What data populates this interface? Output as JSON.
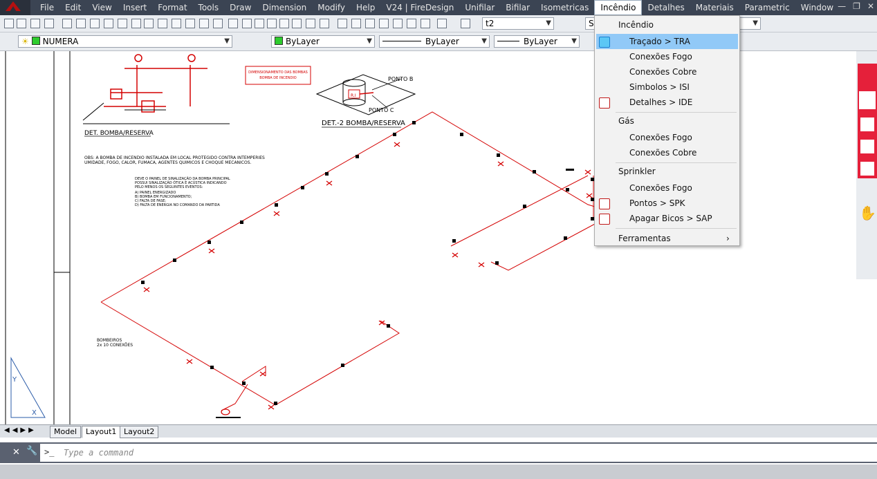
{
  "menubar": {
    "items": [
      "File",
      "Edit",
      "View",
      "Insert",
      "Format",
      "Tools",
      "Draw",
      "Dimension",
      "Modify",
      "Help",
      "V24 | FireDesign",
      "Unifilar",
      "Bifilar",
      "Isometricas",
      "Incêndio",
      "Detalhes",
      "Materiais",
      "Parametric",
      "Window"
    ],
    "active": "Incêndio"
  },
  "toolbar1": {
    "textstyle": "t2",
    "dimstyle": "St"
  },
  "toolbar2": {
    "layer": "NUMERA",
    "color": "ByLayer",
    "linetype": "ByLayer",
    "lineweight": "ByLayer"
  },
  "dropdown": {
    "groups": [
      {
        "header": "Incêndio",
        "items": [
          {
            "label": "Traçado > TRA",
            "icon": "tra-icon",
            "highlight": true
          },
          {
            "label": "Conexões Fogo"
          },
          {
            "label": "Conexões Cobre"
          },
          {
            "label": "Simbolos > ISI"
          },
          {
            "label": "Detalhes > IDE",
            "icon": "ide-icon"
          }
        ]
      },
      {
        "header": "Gás",
        "items": [
          {
            "label": "Conexões Fogo"
          },
          {
            "label": "Conexões Cobre"
          }
        ]
      },
      {
        "header": "Sprinkler",
        "items": [
          {
            "label": "Conexões Fogo"
          },
          {
            "label": "Pontos > SPK",
            "icon": "spk-icon"
          },
          {
            "label": "Apagar Bicos > SAP",
            "icon": "sap-icon"
          }
        ]
      }
    ],
    "footer": "Ferramentas"
  },
  "drawing": {
    "det1": "DET. BOMBA/RESERVA",
    "det2": "DET.-2 BOMBA/RESERVA",
    "ponto_b": "PONTO B",
    "ponto_c": "PONTO C",
    "obs": "OBS: A BOMBA DE INCENDIO INSTALADA EM LOCAL PROTEGIDO CONTRA INTEMPERIES",
    "obs2": "UMIDADE, FOGO, CALOR, FUMACA, AGENTES QUIMICOS E CHOQUE MECANICOS.",
    "note1": "DEVE O PAINEL DE SINALIZAÇÃO DA BOMBA PRINCIPAL",
    "note2": "POSSUI SINALIZAÇÃO ÓTICA E ACÚSTICA INDICANDO",
    "note3": "PELO MENOS OS SEGUINTES EVENTOS:",
    "note4": "A) PAINEL ENERGIZADO",
    "note5": "B) BOMBA EM FUNCIONAMENTO;",
    "note6": "C) FALTA DE FASE;",
    "note7": "D) FALTA DE ENERGIA NO COMANDO DA PARTIDA",
    "box1": "DIMENSIONAMENTO DAS BOMBAS",
    "box2": "BOMBA DE INCENDIO",
    "bicos1": "BOMBEIROS",
    "bicos2": "2x 10 CONEXÕES",
    "tanque": "R.I"
  },
  "tabs": [
    "Model",
    "Layout1",
    "Layout2"
  ],
  "active_tab": "Layout1",
  "command": {
    "placeholder": "Type a command"
  },
  "colors": {
    "pipe": "#d40000",
    "menubar": "#3b4453",
    "highlight": "#91c9f7"
  }
}
